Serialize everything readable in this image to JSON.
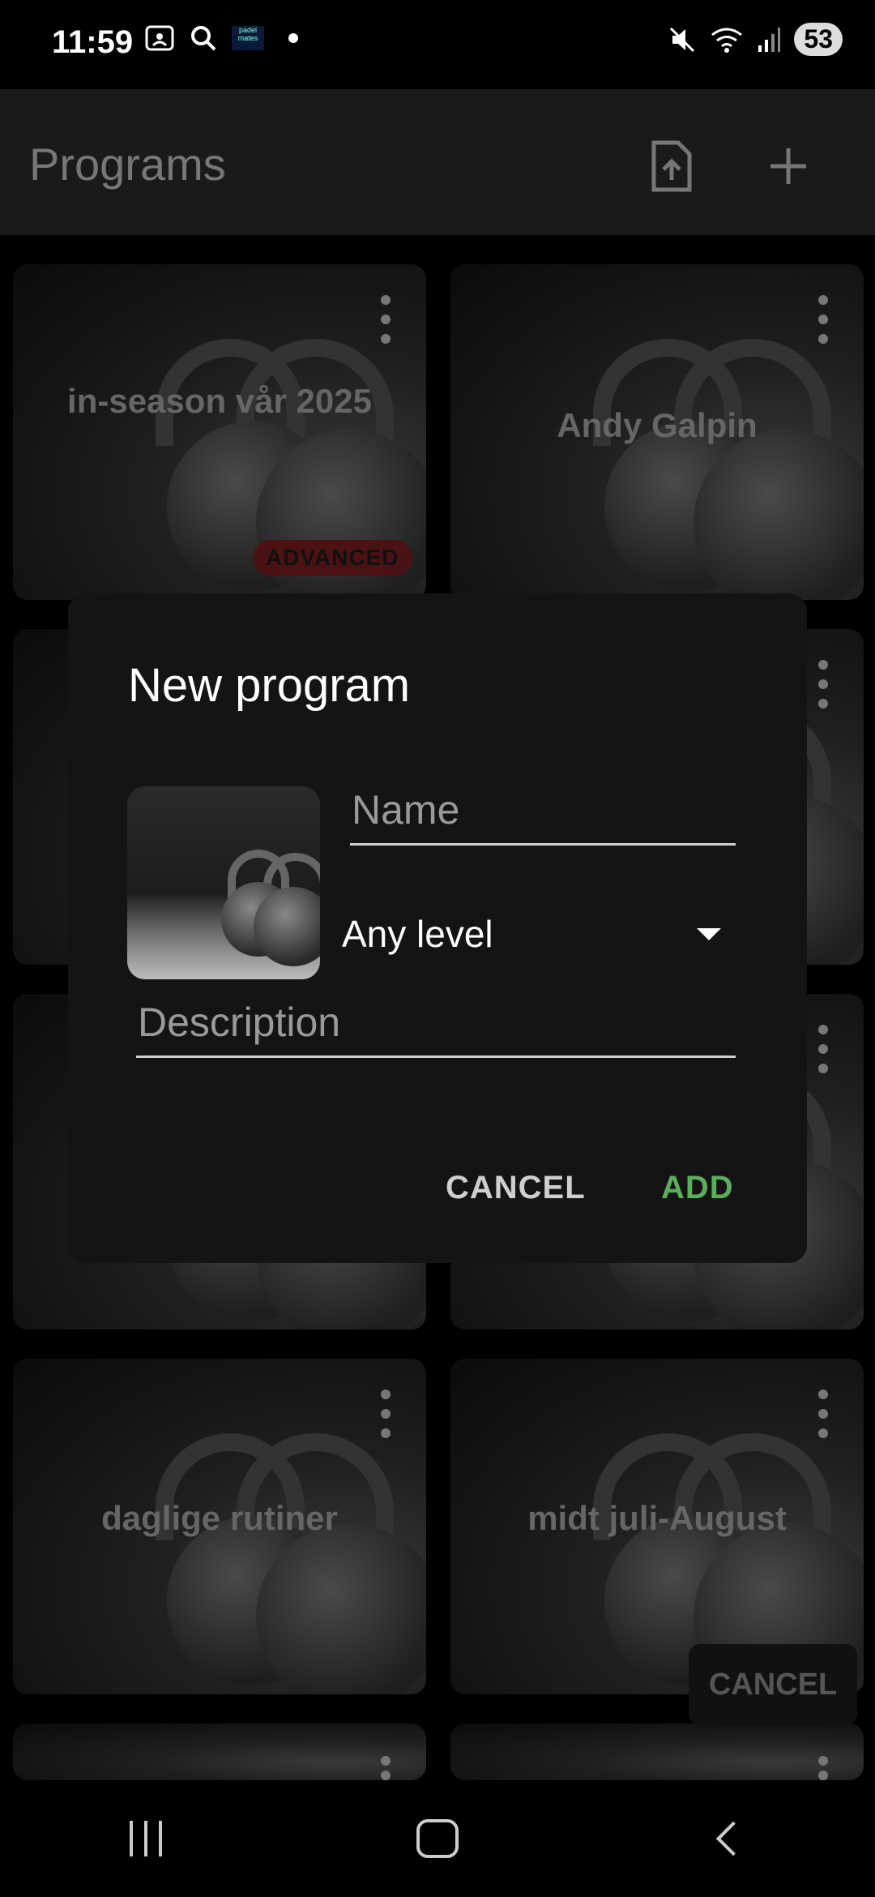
{
  "status_bar": {
    "time": "11:59",
    "app_notification_label": "padel mates",
    "battery": "53",
    "left_icons": [
      "screenshot-icon",
      "search-icon",
      "padelmates-app-icon",
      "dot-icon"
    ],
    "right_icons": [
      "mute-icon",
      "wifi-icon",
      "signal-icon",
      "battery-icon"
    ]
  },
  "appbar": {
    "title": "Programs",
    "actions": [
      "import-file-icon",
      "add-icon"
    ]
  },
  "cards": [
    {
      "title": "in-season vår 2025",
      "badge": "ADVANCED"
    },
    {
      "title": "Andy Galpin",
      "badge": ""
    },
    {
      "title": "",
      "badge": ""
    },
    {
      "title": "",
      "badge": ""
    },
    {
      "title": "",
      "badge": ""
    },
    {
      "title": "",
      "badge": ""
    },
    {
      "title": "daglige rutiner",
      "badge": ""
    },
    {
      "title": "midt juli-August",
      "badge": ""
    }
  ],
  "background_cancel": "CANCEL",
  "dialog": {
    "title": "New program",
    "name_placeholder": "Name",
    "level_value": "Any level",
    "description_placeholder": "Description",
    "cancel_label": "CANCEL",
    "add_label": "ADD",
    "colors": {
      "accent": "#5cae5c",
      "surface": "#141414"
    }
  },
  "navbar": {
    "icons": [
      "recent-apps-icon",
      "home-icon",
      "back-icon"
    ]
  }
}
